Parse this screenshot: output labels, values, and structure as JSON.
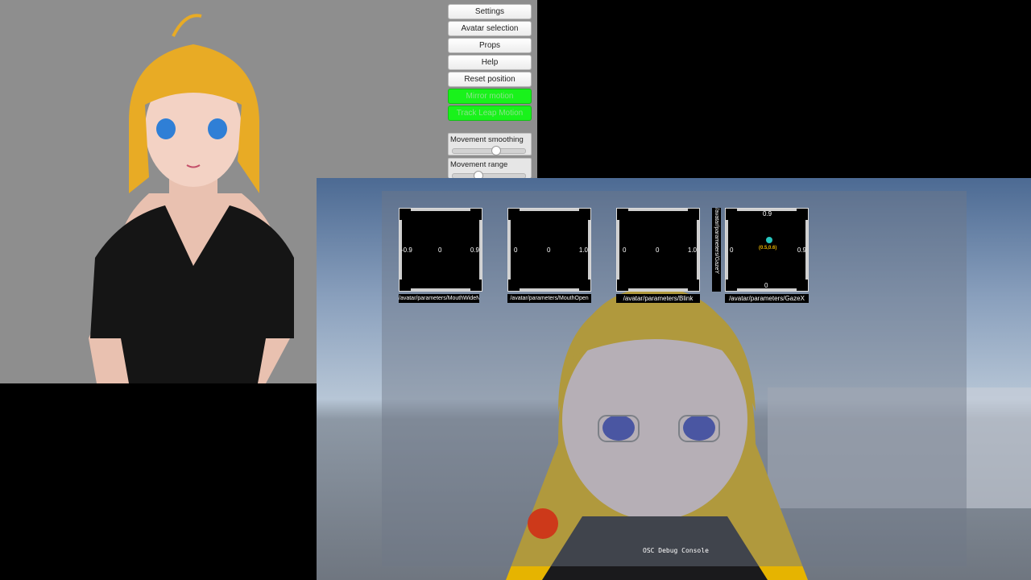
{
  "menu": {
    "items": [
      {
        "label": "Settings",
        "active": false
      },
      {
        "label": "Avatar selection",
        "active": false
      },
      {
        "label": "Props",
        "active": false
      },
      {
        "label": "Help",
        "active": false
      },
      {
        "label": "Reset position",
        "active": false
      },
      {
        "label": "Mirror motion",
        "active": true
      },
      {
        "label": "Track Leap Motion",
        "active": true
      }
    ]
  },
  "sliders": {
    "smoothing": {
      "label": "Movement smoothing",
      "value": 0.6
    },
    "range": {
      "label": "Movement range",
      "value": 0.33
    }
  },
  "debug": {
    "params": [
      {
        "name": "/avatar/parameters/MouthWideNarrow",
        "min": "-0.9",
        "mid": "0",
        "max": "0.9"
      },
      {
        "name": "/avatar/parameters/MouthOpen",
        "min": "0",
        "mid": "0",
        "max": "1.0"
      },
      {
        "name": "/avatar/parameters/Blink",
        "min": "0",
        "mid": "0",
        "max": "1.0"
      },
      {
        "name": "/avatar/parameters/GazeX",
        "min": "0",
        "max": "0.9",
        "top": "0.9",
        "bottom": "0",
        "value": "(0.5,0.6)"
      }
    ],
    "gaze_y_label": "/avatar/parameters/GazeY",
    "console_label": "OSC Debug Console"
  },
  "colors": {
    "active_button": "#19f21b",
    "gaze_dot": "#27c7c0",
    "gaze_value": "#e8b400"
  }
}
